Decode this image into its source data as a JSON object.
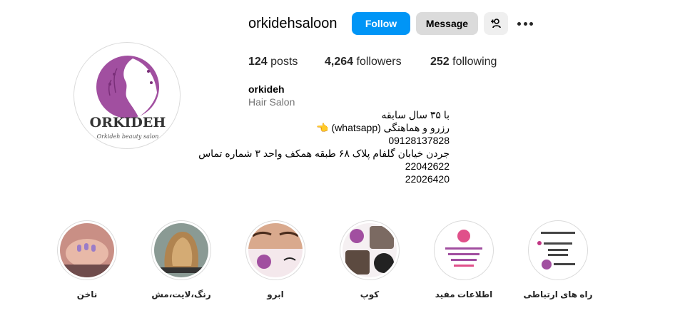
{
  "profile": {
    "username": "orkidehsaloon",
    "follow_label": "Follow",
    "message_label": "Message",
    "logo_text": "ORKIDEH",
    "logo_subtext": "Orkideh beauty salon"
  },
  "stats": {
    "posts_count": "124",
    "posts_label": "posts",
    "followers_count": "4,264",
    "followers_label": "followers",
    "following_count": "252",
    "following_label": "following"
  },
  "bio": {
    "name": "orkideh",
    "category": "Hair Salon",
    "lines": [
      "با ۳۵ سال سابقه",
      "رزرو و هماهنگی (whatsapp) 👈",
      "09128137828",
      "جردن خیابان گلفام پلاک ۶۸ طبقه همکف واحد ۳ شماره تماس",
      "22042622",
      "22026420"
    ]
  },
  "highlights": [
    {
      "label": "ناخن",
      "icon": "nails-photo"
    },
    {
      "label": "رنگ،لایت،مش",
      "icon": "hair-color-photo"
    },
    {
      "label": "ابرو",
      "icon": "eyebrow-photo"
    },
    {
      "label": "کوپ",
      "icon": "haircut-photo"
    },
    {
      "label": "اطلاعات مفید",
      "icon": "info-card"
    },
    {
      "label": "راه های ارتباطی",
      "icon": "contact-card"
    }
  ],
  "colors": {
    "follow_blue": "#0095f6",
    "brand_purple": "#a14fa0",
    "message_gray": "#dbdbdb"
  }
}
